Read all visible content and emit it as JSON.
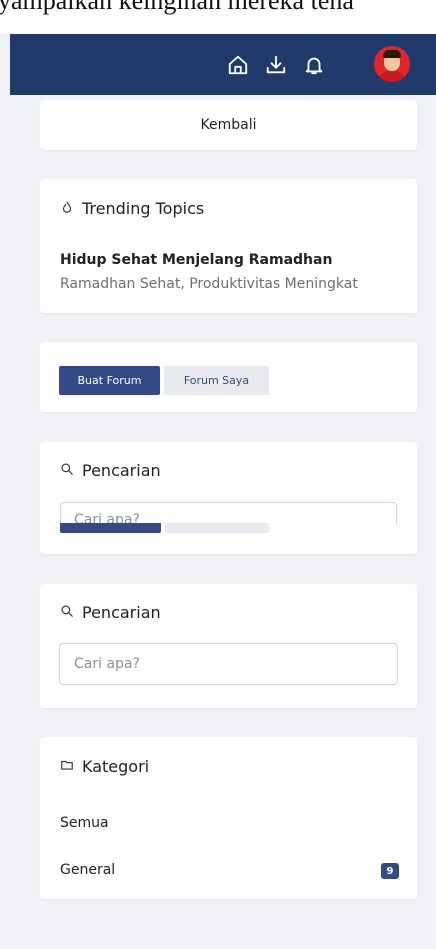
{
  "top_fragment": "yampaikan keinginan mereka tena",
  "colors": {
    "navbar": "#1f3a6b",
    "primary": "#344a86",
    "badge": "#344a86"
  },
  "navbar": {
    "icons": [
      "home-icon",
      "download-icon",
      "bell-icon"
    ],
    "avatar": "user-avatar"
  },
  "back_button": {
    "label": "Kembali"
  },
  "trending": {
    "title": "Trending Topics",
    "icon": "flame-icon",
    "topic_title": "Hidup Sehat Menjelang Ramadhan",
    "topic_subtitle": "Ramadhan Sehat, Produktivitas Meningkat"
  },
  "forum_actions": {
    "create_label": "Buat Forum",
    "mine_label": "Forum Saya"
  },
  "search_ghost": {
    "title": "Pencarian",
    "placeholder": "Cari apa?"
  },
  "search": {
    "title": "Pencarian",
    "placeholder": "Cari apa?",
    "icon": "search-icon"
  },
  "categories": {
    "title": "Kategori",
    "icon": "folder-icon",
    "items": [
      {
        "label": "Semua"
      },
      {
        "label": "General",
        "count": "9"
      }
    ]
  }
}
